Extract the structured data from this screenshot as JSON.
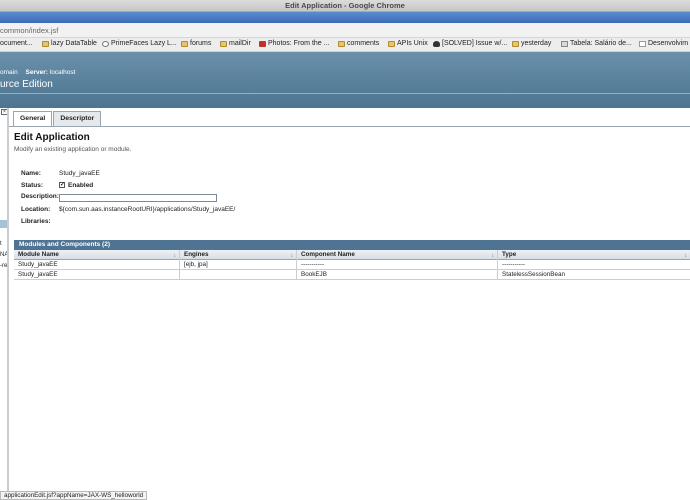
{
  "window": {
    "title": "Edit Application - Google Chrome"
  },
  "browser": {
    "url": "common/index.jsf",
    "bookmarks": [
      {
        "label": "ocument...",
        "icon": "page-icon"
      },
      {
        "label": "lazy DataTable",
        "icon": "folder-icon"
      },
      {
        "label": "PrimeFaces Lazy L...",
        "icon": "wikipedia-icon"
      },
      {
        "label": "forums",
        "icon": "folder-icon"
      },
      {
        "label": "mailDir",
        "icon": "folder-icon"
      },
      {
        "label": "Photos: From the ...",
        "icon": "red-site-icon"
      },
      {
        "label": "comments",
        "icon": "folder-icon"
      },
      {
        "label": "APIs Unix",
        "icon": "folder-icon"
      },
      {
        "label": "[SOLVED] Issue w/...",
        "icon": "tux-icon"
      },
      {
        "label": "yesterday",
        "icon": "folder-icon"
      },
      {
        "label": "Tabela: Salário de...",
        "icon": "doc-icon"
      },
      {
        "label": "Desenvolvim",
        "icon": "page-icon"
      }
    ]
  },
  "masthead": {
    "domain_text": "omain",
    "server_label": "Server:",
    "server_value": "localhost",
    "product": "urce Edition"
  },
  "leftnav": {
    "close_glyph": "×",
    "snippets": [
      "t",
      "NA",
      "-re"
    ]
  },
  "tabs": [
    {
      "label": "General",
      "active": true
    },
    {
      "label": "Descriptor",
      "active": false
    }
  ],
  "page": {
    "title": "Edit Application",
    "help": "Modify an existing application or module.",
    "fields": {
      "name_label": "Name:",
      "name_value": "Study_javaEE",
      "status_label": "Status:",
      "status_checkbox": "✓",
      "status_value": "Enabled",
      "description_label": "Description:",
      "description_value": "",
      "location_label": "Location:",
      "location_value": "${com.sun.aas.instanceRootURI}/applications/Study_javaEE/",
      "libraries_label": "Libraries:"
    }
  },
  "table": {
    "title": "Modules and Components (2)",
    "sort_glyph": "↕",
    "columns": [
      "Module Name",
      "Engines",
      "Component Name",
      "Type"
    ],
    "rows": [
      [
        "Study_javaEE",
        "[ejb, jpa]",
        "-----------",
        "-----------"
      ],
      [
        "Study_javaEE",
        "",
        "BookEJB",
        "StatelessSessionBean"
      ]
    ]
  },
  "statusbar": {
    "text": "applicationEdit.jsf?appName=JAX-WS_helloworld"
  }
}
